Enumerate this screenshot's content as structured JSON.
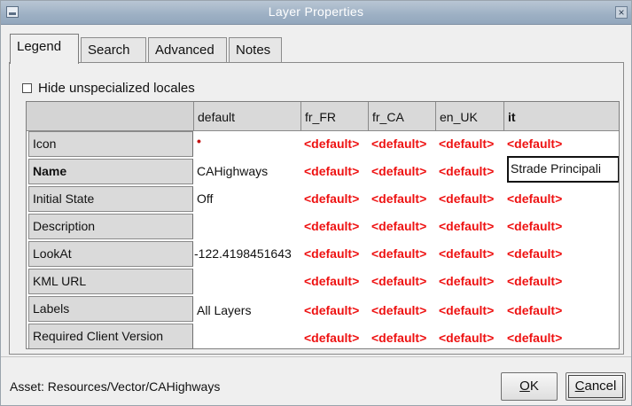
{
  "window": {
    "title": "Layer Properties"
  },
  "tabs": [
    {
      "label": "Legend"
    },
    {
      "label": "Search"
    },
    {
      "label": "Advanced"
    },
    {
      "label": "Notes"
    }
  ],
  "hide_unspecialized": {
    "label": "Hide unspecialized locales",
    "checked": false
  },
  "table": {
    "columns": [
      "default",
      "fr_FR",
      "fr_CA",
      "en_UK",
      "it"
    ],
    "rows": [
      {
        "label": "Icon",
        "default": "•",
        "fr_FR": "<default>",
        "fr_CA": "<default>",
        "en_UK": "<default>",
        "it": "<default>"
      },
      {
        "label": "Name",
        "default": "CAHighways",
        "fr_FR": "<default>",
        "fr_CA": "<default>",
        "en_UK": "<default>",
        "it": "Strade Principali"
      },
      {
        "label": "Initial State",
        "default": "Off",
        "fr_FR": "<default>",
        "fr_CA": "<default>",
        "en_UK": "<default>",
        "it": "<default>"
      },
      {
        "label": "Description",
        "default": "",
        "fr_FR": "<default>",
        "fr_CA": "<default>",
        "en_UK": "<default>",
        "it": "<default>"
      },
      {
        "label": "LookAt",
        "default": "-122.4198451643",
        "fr_FR": "<default>",
        "fr_CA": "<default>",
        "en_UK": "<default>",
        "it": "<default>"
      },
      {
        "label": "KML URL",
        "default": "",
        "fr_FR": "<default>",
        "fr_CA": "<default>",
        "en_UK": "<default>",
        "it": "<default>"
      },
      {
        "label": "Labels",
        "default": "All Layers",
        "fr_FR": "<default>",
        "fr_CA": "<default>",
        "en_UK": "<default>",
        "it": "<default>"
      },
      {
        "label": "Required Client Version",
        "default": "",
        "fr_FR": "<default>",
        "fr_CA": "<default>",
        "en_UK": "<default>",
        "it": "<default>"
      }
    ]
  },
  "footer": {
    "asset": "Asset: Resources/Vector/CAHighways",
    "ok_mnemonic": "O",
    "ok_rest": "K",
    "cancel_mnemonic": "C",
    "cancel_rest": "ancel"
  },
  "colors": {
    "default_text": "#ee1111",
    "title_bar": "#9db0c4"
  }
}
